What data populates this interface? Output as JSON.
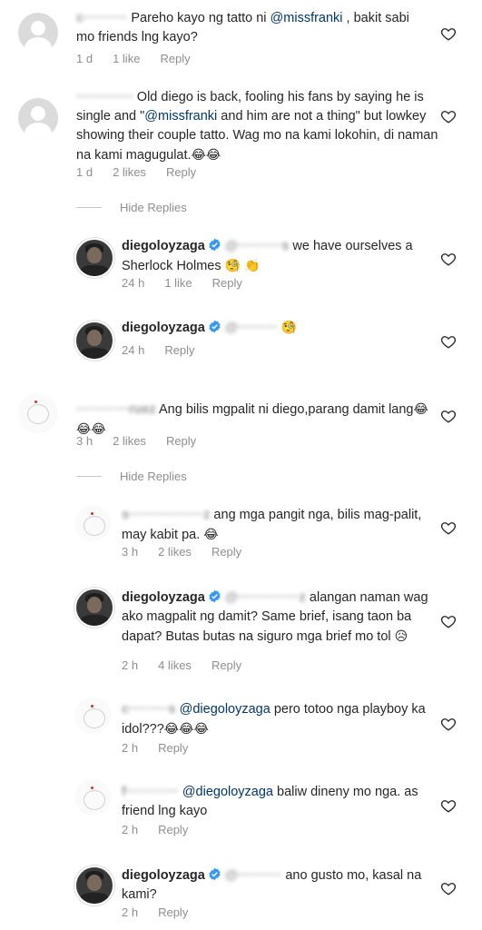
{
  "comments": [
    {
      "user_blurred": "c··········",
      "text": "Pareho kayo ng tatto ni ",
      "mention": "@missfranki",
      "text2": " , bakit sabi mo friends lng kayo?",
      "time": "1 d",
      "likes": "1 like",
      "reply": "Reply"
    },
    {
      "user_blurred": "·············",
      "text": " Old  diego is back, fooling his fans by saying he is single and \"",
      "mention": "@missfranki",
      "text2": " and him are not a thing\" but lowkey showing their couple tatto. Wag mo na kami lokohin, di naman na kami magugulat.",
      "emoji": "😂😂",
      "time": "1 d",
      "likes": "2 likes",
      "reply": "Reply"
    },
    {
      "time": "24 h",
      "likes": "1 like",
      "reply": "Reply",
      "username": "diegoloyzaga",
      "mention_blurred": "@··········s",
      "text": " we have ourselves a Sherlock Holmes ",
      "emoji": "🧐 👏"
    },
    {
      "time": "24 h",
      "reply": "Reply",
      "username": "diegoloyzaga",
      "mention_blurred": "@·········",
      "emoji": "🧐"
    },
    {
      "user_blurred": "············ruez",
      "text": " Ang bilis mgpalit ni diego,parang damit lang",
      "emoji": "😂😂😂",
      "time": "3 h",
      "likes": "2 likes",
      "reply": "Reply"
    },
    {
      "user_blurred": "s·················z",
      "text": " ang mga pangit nga, bilis mag-palit, may kabit pa. ",
      "emoji": "😂",
      "time": "3 h",
      "likes": "2 likes",
      "reply": "Reply"
    },
    {
      "username": "diegoloyzaga",
      "mention_blurred": "@··············z",
      "text": " alangan naman wag ako magpalit ng damit? Same brief, isang taon ba dapat? Butas butas na siguro mga brief mo tol ",
      "emoji": "😥",
      "time": "2 h",
      "likes": "4 likes",
      "reply": "Reply"
    },
    {
      "user_blurred": "c·········s",
      "mention": "@diegoloyzaga",
      "text": " pero totoo nga playboy ka idol???",
      "emoji": "😂😂😂",
      "time": "2 h",
      "reply": "Reply"
    },
    {
      "user_blurred": "f············",
      "mention": "@diegoloyzaga",
      "text": " baliw dineny mo nga. as friend lng kayo",
      "time": "2 h",
      "reply": "Reply"
    },
    {
      "username": "diegoloyzaga",
      "mention_blurred": "@··········",
      "text": " ano gusto mo, kasal na kami?",
      "time": "2 h",
      "reply": "Reply"
    }
  ],
  "hide_replies_1": "Hide Replies",
  "hide_replies_2": "Hide Replies",
  "colors": {
    "verified": "#3897f0",
    "mention": "#00376b",
    "meta": "#8e8e8e"
  }
}
